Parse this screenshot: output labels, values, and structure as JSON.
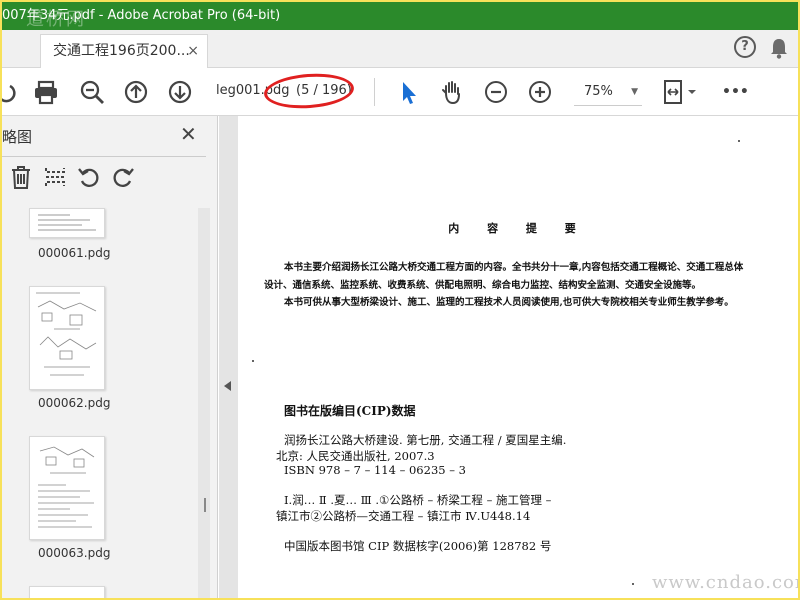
{
  "window": {
    "title": "007年34元.pdf - Adobe Acrobat Pro (64-bit)",
    "watermark_title": "道桥网"
  },
  "tab": {
    "label": "交通工程196页200...",
    "close": "×"
  },
  "help_icon": "?",
  "toolbar": {
    "filename": "leg001.pdg",
    "page_indicator": "(5 / 196)",
    "zoom": "75%",
    "more": "•••"
  },
  "sidebar": {
    "title": "略图",
    "close": "✕",
    "thumbnails": [
      {
        "label": "000061.pdg"
      },
      {
        "label": "000062.pdg"
      },
      {
        "label": "000063.pdg"
      }
    ]
  },
  "document": {
    "heading": "内 容 提 要",
    "para1_line1": "本书主要介绍润扬长江公路大桥交通工程方面的内容。全书共分十一章,内容包括交通工程概论、交通工程总体",
    "para1_line2": "设计、通信系统、监控系统、收费系统、供配电照明、综合电力监控、结构安全监测、交通安全设施等。",
    "para2": "本书可供从事大型桥梁设计、施工、监理的工程技术人员阅读使用,也可供大专院校相关专业师生教学参考。",
    "cip_title": "图书在版编目(CIP)数据",
    "cip_line1": "润扬长江公路大桥建设. 第七册, 交通工程 / 夏国星主编.",
    "cip_line2": "北京: 人民交通出版社, 2007.3",
    "cip_line3": "ISBN 978 – 7 – 114 – 06235 – 3",
    "cip_line4": "Ⅰ.润… Ⅱ .夏… Ⅲ .①公路桥 – 桥梁工程 – 施工管理 –",
    "cip_line5": "镇江市②公路桥—交通工程 – 镇江市 Ⅳ.U448.14",
    "cip_line6": "中国版本图书馆 CIP 数据核字(2006)第 128782 号"
  },
  "site_watermark": "www.cndao.com",
  "colors": {
    "titlebar": "#2b8a2b",
    "annotation": "#e02020",
    "select_tool": "#1a6fd4",
    "outer_border": "#f7e15a"
  }
}
